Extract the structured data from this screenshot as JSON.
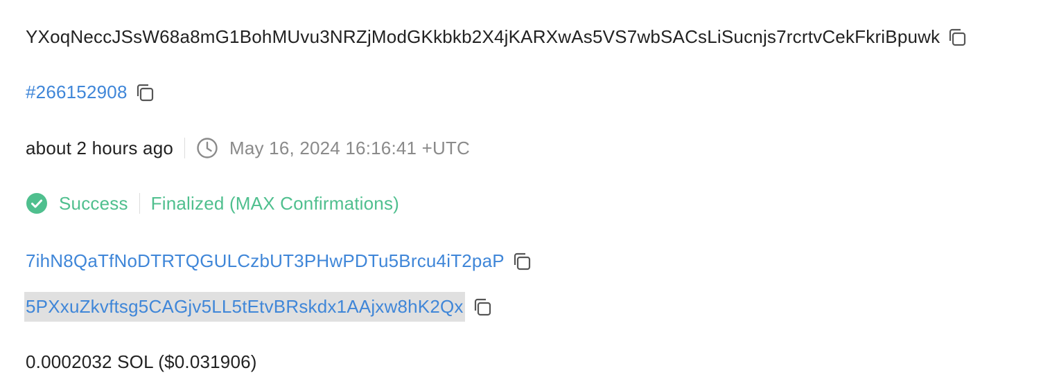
{
  "transaction": {
    "signature": "YXoqNeccJSsW68a8mG1BohMUvu3NRZjModGKkbkb2X4jKARXwAs5VS7wbSACsLiSucnjs7rcrtvCekFkriBpuwk",
    "block": "#266152908",
    "relative_time": "about 2 hours ago",
    "timestamp": "May 16, 2024 16:16:41 +UTC",
    "status": "Success",
    "confirmation": "Finalized (MAX Confirmations)",
    "signer": "7ihN8QaTfNoDTRTQGULCzbUT3PHwPDTu5Brcu4iT2paP",
    "fee_payer": "5PXxuZkvftsg5CAGjv5LL5tEtvBRskdx1AAjxw8hK2Qx",
    "fee": "0.0002032 SOL ($0.031906)"
  },
  "icons": {
    "copy": "copy-icon",
    "clock": "clock-icon",
    "success": "check-circle-icon"
  },
  "colors": {
    "link": "#3f86d8",
    "success": "#4fbf8e",
    "muted": "#8a8a8a",
    "text": "#222222",
    "highlight": "#e0e0e0"
  }
}
